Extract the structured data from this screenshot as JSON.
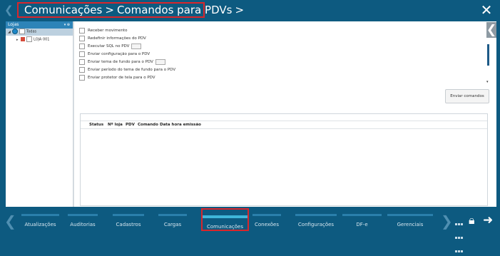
{
  "header": {
    "breadcrumb": [
      "Comunicações",
      "Comandos para PDVs"
    ],
    "separator": ">"
  },
  "left_panel": {
    "title": "Lojas",
    "controls": "▾ ⊕",
    "tree": [
      {
        "label": "Todas",
        "level": 0
      },
      {
        "label": "LOJA 001",
        "level": 1
      }
    ]
  },
  "commands": [
    "Receber movimento",
    "Redefinir informações do PDV",
    "Executar SQL no PDV",
    "Enviar configuração para o PDV",
    "Enviar tema de fundo para o PDV",
    "Enviar período do tema de fundo para o PDV",
    "Enviar protetor de tela para o PDV"
  ],
  "send_button": "Enviar comandos",
  "table": {
    "columns": [
      "Status",
      "Nº loja",
      "PDV",
      "Comando",
      "Data hora emissão"
    ]
  },
  "bottom_nav": [
    {
      "label": "Atualizações",
      "active": false
    },
    {
      "label": "Auditorias",
      "active": false
    },
    {
      "label": "Cadastros",
      "active": false
    },
    {
      "label": "Cargas",
      "active": false
    },
    {
      "label": "Comunicações",
      "active": true
    },
    {
      "label": "Conexões",
      "active": false
    },
    {
      "label": "Configurações",
      "active": false
    },
    {
      "label": "DF-e",
      "active": false
    },
    {
      "label": "Gerenciais",
      "active": false
    }
  ],
  "colors": {
    "background": "#0d5a80",
    "accent": "#3fb6d9",
    "highlight_border": "#d9262b"
  },
  "icons": [
    "close-icon",
    "back-arrow-icon",
    "grid-icon",
    "lock-icon",
    "exit-arrow-icon"
  ]
}
